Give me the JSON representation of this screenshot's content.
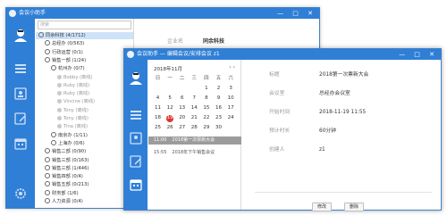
{
  "win1": {
    "title": "会议小助手",
    "controls": "— □ ✕",
    "search_placeholder": "搜索",
    "tree": [
      {
        "label": "同余科技 (4/1712)",
        "indent": 0,
        "kind": "org",
        "selected": true
      },
      {
        "label": "总经办 (0/563)",
        "indent": 1,
        "kind": "org"
      },
      {
        "label": "行政运营 (0/1)",
        "indent": 1,
        "kind": "org"
      },
      {
        "label": "销售一部 (1/24)",
        "indent": 1,
        "kind": "org"
      },
      {
        "label": "杭州办 (0/7)",
        "indent": 2,
        "kind": "org"
      },
      {
        "label": "Bobby (离线)",
        "indent": 3,
        "kind": "user"
      },
      {
        "label": "Ruby (离线)",
        "indent": 3,
        "kind": "user"
      },
      {
        "label": "Ruby (离线)",
        "indent": 3,
        "kind": "user"
      },
      {
        "label": "Vincine (离线)",
        "indent": 3,
        "kind": "user"
      },
      {
        "label": "Tony (离线)",
        "indent": 3,
        "kind": "user"
      },
      {
        "label": "Tony (离线)",
        "indent": 3,
        "kind": "user"
      },
      {
        "label": "Tina (离线)",
        "indent": 3,
        "kind": "user"
      },
      {
        "label": "南京办 (1/11)",
        "indent": 2,
        "kind": "org"
      },
      {
        "label": "上海办 (0/6)",
        "indent": 2,
        "kind": "org"
      },
      {
        "label": "销售二部 (0/90)",
        "indent": 1,
        "kind": "org"
      },
      {
        "label": "销售三部 (0/163)",
        "indent": 1,
        "kind": "org"
      },
      {
        "label": "销售三部 (1/446)",
        "indent": 1,
        "kind": "org"
      },
      {
        "label": "销售四部 (0/4)",
        "indent": 1,
        "kind": "org"
      },
      {
        "label": "销售五部 (0/213)",
        "indent": 1,
        "kind": "org"
      },
      {
        "label": "财务部 (1/6)",
        "indent": 1,
        "kind": "org"
      },
      {
        "label": "人力资源 (0/4)",
        "indent": 1,
        "kind": "org"
      }
    ],
    "tabs": [
      {
        "label": "企业名",
        "active": false
      },
      {
        "label": "同余科技",
        "active": true
      }
    ]
  },
  "win2": {
    "title": "会议助手 — 编辑会议/安排会议 z1",
    "controls": "— □ ✕",
    "month_label": "2018年11月",
    "nav": "‹ ›",
    "weekdays": [
      "日",
      "一",
      "二",
      "三",
      "四",
      "五",
      "六"
    ],
    "weeks": [
      [
        "",
        "",
        "",
        "",
        "1",
        "2",
        "3"
      ],
      [
        "4",
        "5",
        "6",
        "7",
        "8",
        "9",
        "10"
      ],
      [
        "11",
        "12",
        "13",
        "14",
        "15",
        "16",
        "17"
      ],
      [
        "18",
        "19",
        "20",
        "21",
        "22",
        "23",
        "24"
      ],
      [
        "25",
        "26",
        "27",
        "28",
        "29",
        "30",
        ""
      ]
    ],
    "today": "19",
    "events": [
      {
        "time": "11:00",
        "title": "2018第一次票新大会",
        "selected": true
      },
      {
        "time": "15:55",
        "title": "2018年下午销售会议",
        "selected": false
      }
    ],
    "details": [
      {
        "label": "标题",
        "value": "2018第一次票新大会"
      },
      {
        "label": "会议室",
        "value": "总经办会议室"
      },
      {
        "label": "开始时间",
        "value": "2018-11-19 11:55"
      },
      {
        "label": "预计时长",
        "value": "60分钟"
      },
      {
        "label": "创建人",
        "value": "z1"
      }
    ],
    "buttons": {
      "edit": "修改",
      "delete": "删除"
    }
  },
  "colors": {
    "accent": "#2f7fd6",
    "selected_row": "#cfe3f8",
    "today": "#e0342f",
    "selected_event": "#9c9c9c"
  }
}
